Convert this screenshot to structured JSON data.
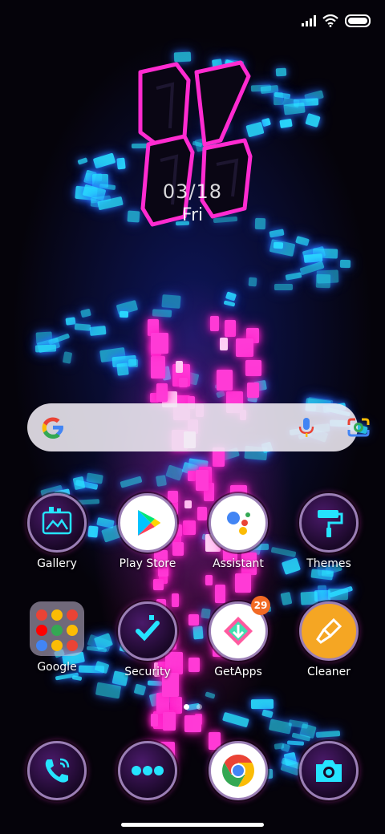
{
  "clock": {
    "date": "03/18",
    "day": "Fri"
  },
  "search": {
    "placeholder": ""
  },
  "apps_row1": [
    {
      "name": "gallery",
      "label": "Gallery"
    },
    {
      "name": "play-store",
      "label": "Play Store"
    },
    {
      "name": "assistant",
      "label": "Assistant"
    },
    {
      "name": "themes",
      "label": "Themes"
    }
  ],
  "apps_row2": [
    {
      "name": "google-folder",
      "label": "Google"
    },
    {
      "name": "security",
      "label": "Security"
    },
    {
      "name": "getapps",
      "label": "GetApps",
      "badge": "29"
    },
    {
      "name": "cleaner",
      "label": "Cleaner"
    }
  ],
  "dock": [
    {
      "name": "phone",
      "icon": "phone-icon"
    },
    {
      "name": "messages",
      "icon": "more-dots-icon"
    },
    {
      "name": "chrome",
      "icon": "chrome-icon"
    },
    {
      "name": "camera",
      "icon": "camera-icon"
    }
  ],
  "page_indicator": {
    "pages": 2,
    "current": 1
  },
  "colors": {
    "neon_pink": "#ff3ad6",
    "neon_blue": "#2ad8ff",
    "badge": "#f26a24"
  }
}
